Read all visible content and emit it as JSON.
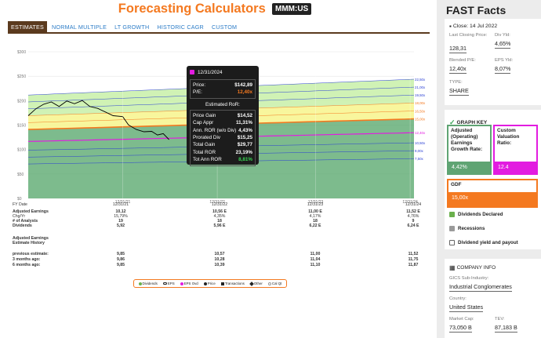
{
  "header": {
    "title": "Forecasting Calculators",
    "ticker": "MMM:US"
  },
  "tabs": [
    "ESTIMATES",
    "NORMAL MULTIPLE",
    "LT GROWTH",
    "HISTORIC CAGR",
    "CUSTOM"
  ],
  "chart_data": {
    "type": "area",
    "y_ticks": [
      "$300",
      "$250",
      "$200",
      "$150",
      "$100",
      "$50",
      "$0"
    ],
    "x_ticks": [
      "12/31/21",
      "12/31/22",
      "12/31/23",
      "12/31/24"
    ],
    "ylim": [
      0,
      300
    ],
    "pe_band_labels": [
      "22,50x",
      "21,00x",
      "19,50x",
      "18,00x",
      "16,50x",
      "15,00x",
      "12,40x",
      "10,50x",
      "9,00x",
      "7,50x"
    ],
    "colors": {
      "band_top": "#c8f0a8",
      "band_mid": "#f7f48c",
      "band_low": "#8fd18e",
      "area_green": "#5daa70",
      "orange_line": "#f47920",
      "magenta_line": "#e21ce0",
      "blue_line": "#2a3fd4",
      "price_line": "#000000"
    }
  },
  "tooltip": {
    "date": "12/31/2024",
    "price_label": "Price:",
    "price": "$142,89",
    "pe_label": "P/E:",
    "pe": "12,40x",
    "ror_header": "Estimated RoR:",
    "rows": [
      {
        "label": "Price Gain",
        "value": "$14,52"
      },
      {
        "label": "Cap Appr",
        "value": "11,31%"
      },
      {
        "label": "Ann. ROR (w/o Div)",
        "value": "4,43%"
      },
      {
        "label": "Prorated Div",
        "value": "$15,25"
      },
      {
        "label": "Total Gain",
        "value": "$29,77"
      },
      {
        "label": "Total ROR",
        "value": "23,19%"
      },
      {
        "label": "Tot Ann ROR",
        "value": "8,81%"
      }
    ]
  },
  "table": {
    "rows": [
      {
        "label": "FY Date",
        "cells": [
          "12/31/21",
          "12/31/22",
          "12/31/23",
          "12/31/24"
        ],
        "bold": false
      },
      {
        "label": "Adjusted Earnings",
        "cells": [
          "10,12",
          "10,56 E",
          "11,00 E",
          "11,52 E"
        ],
        "bold": true
      },
      {
        "label": "Chg/Yr",
        "cells": [
          "15,79%",
          "4,35%",
          "4,17%",
          "4,76%"
        ],
        "bold": false
      },
      {
        "label": "# of Analysts",
        "cells": [
          "19",
          "18",
          "18",
          "9"
        ],
        "bold": true
      },
      {
        "label": "Dividends",
        "cells": [
          "5,92",
          "5,96 E",
          "6,22 E",
          "6,24 E"
        ],
        "bold": true
      },
      {
        "label": "Adjusted Earnings",
        "cells": [
          "",
          "",
          "",
          ""
        ],
        "bold": true
      },
      {
        "label": "Estimate History",
        "cells": [
          "",
          "",
          "",
          ""
        ],
        "bold": true
      },
      {
        "label": "previous estimate:",
        "cells": [
          "9,85",
          "10,57",
          "11,00",
          "11,52"
        ],
        "bold": true
      },
      {
        "label": "3 months ago:",
        "cells": [
          "9,86",
          "10,28",
          "11,04",
          "11,75"
        ],
        "bold": true
      },
      {
        "label": "6 months ago:",
        "cells": [
          "9,85",
          "10,39",
          "11,10",
          "11,87"
        ],
        "bold": true
      }
    ]
  },
  "legend": [
    "Dividends",
    "EPS",
    "EPS Ovd",
    "Price",
    "Transactions",
    "Other",
    "Cal Qt"
  ],
  "side": {
    "title": "FAST Facts",
    "close_label": "Close: 14 Jul 2022",
    "last_close_label": "Last Closing Price:",
    "last_close": "128,31",
    "div_yld_label": "Div Yld:",
    "div_yld": "4,65%",
    "blended_pe_label": "Blended P/E:",
    "blended_pe": "12,40x",
    "eps_yld_label": "EPS Yld:",
    "eps_yld": "8,07%",
    "type_label": "TYPE:",
    "type": "SHARE",
    "graph_key_title": "GRAPH KEY",
    "adj_label": "Adjusted (Operating) Earnings Growth Rate:",
    "adj_value": "4,42%",
    "custom_label": "Custom Valuation Ratio:",
    "custom_value": "12.4",
    "gdf_label": "GDF",
    "gdf_value": "15,00x",
    "checks": [
      "Dividends Declared",
      "Recessions",
      "Dividend yield and payout"
    ],
    "company_title": "COMPANY INFO",
    "gics_label": "GICS Sub-Industry:",
    "gics": "Industrial Conglomerates",
    "country_label": "Country:",
    "country": "United States",
    "mcap_label": "Market Cap:",
    "mcap": "73,050 B",
    "tev_label": "TEV:",
    "tev": "87,183 B"
  }
}
